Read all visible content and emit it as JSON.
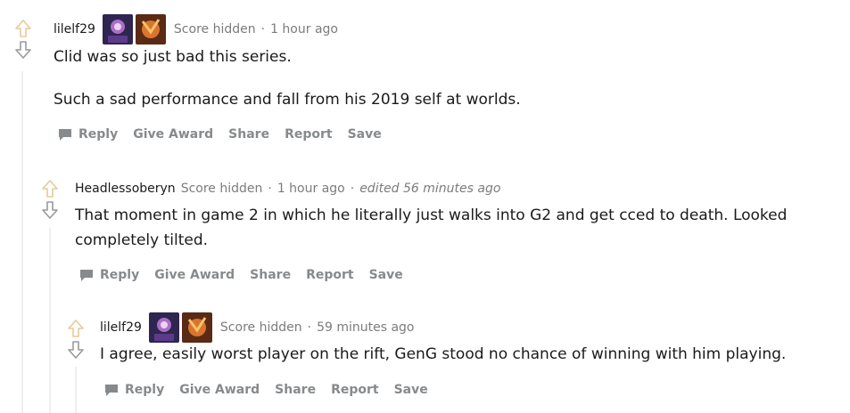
{
  "comments": [
    {
      "author": "lilelf29",
      "score": "Score hidden",
      "separator": "·",
      "time": "1 hour ago",
      "edited": "",
      "paragraphs": [
        "Clid was so just bad this series.",
        "Such a sad performance and fall from his 2019 self at worlds."
      ]
    },
    {
      "author": "Headlessoberyn",
      "score": "Score hidden",
      "separator": "·",
      "time": "1 hour ago",
      "edited": "edited 56 minutes ago",
      "paragraphs": [
        "That moment in game 2 in which he literally just walks into G2 and get cced to death. Looked",
        "completely tilted."
      ]
    },
    {
      "author": "lilelf29",
      "score": "Score hidden",
      "separator": "·",
      "time": "59 minutes ago",
      "edited": "",
      "paragraphs": [
        "I agree, easily worst player on the rift, GenG stood no chance of winning with him playing."
      ]
    }
  ],
  "actions": {
    "reply": "Reply",
    "give_award": "Give Award",
    "share": "Share",
    "report": "Report",
    "save": "Save"
  },
  "colors": {
    "upvote": "#e8c99a",
    "downvote": "#9a9a9a",
    "thread_line": "#edeff1",
    "action_text": "#878a8c",
    "meta_text": "#7c7c7c"
  }
}
